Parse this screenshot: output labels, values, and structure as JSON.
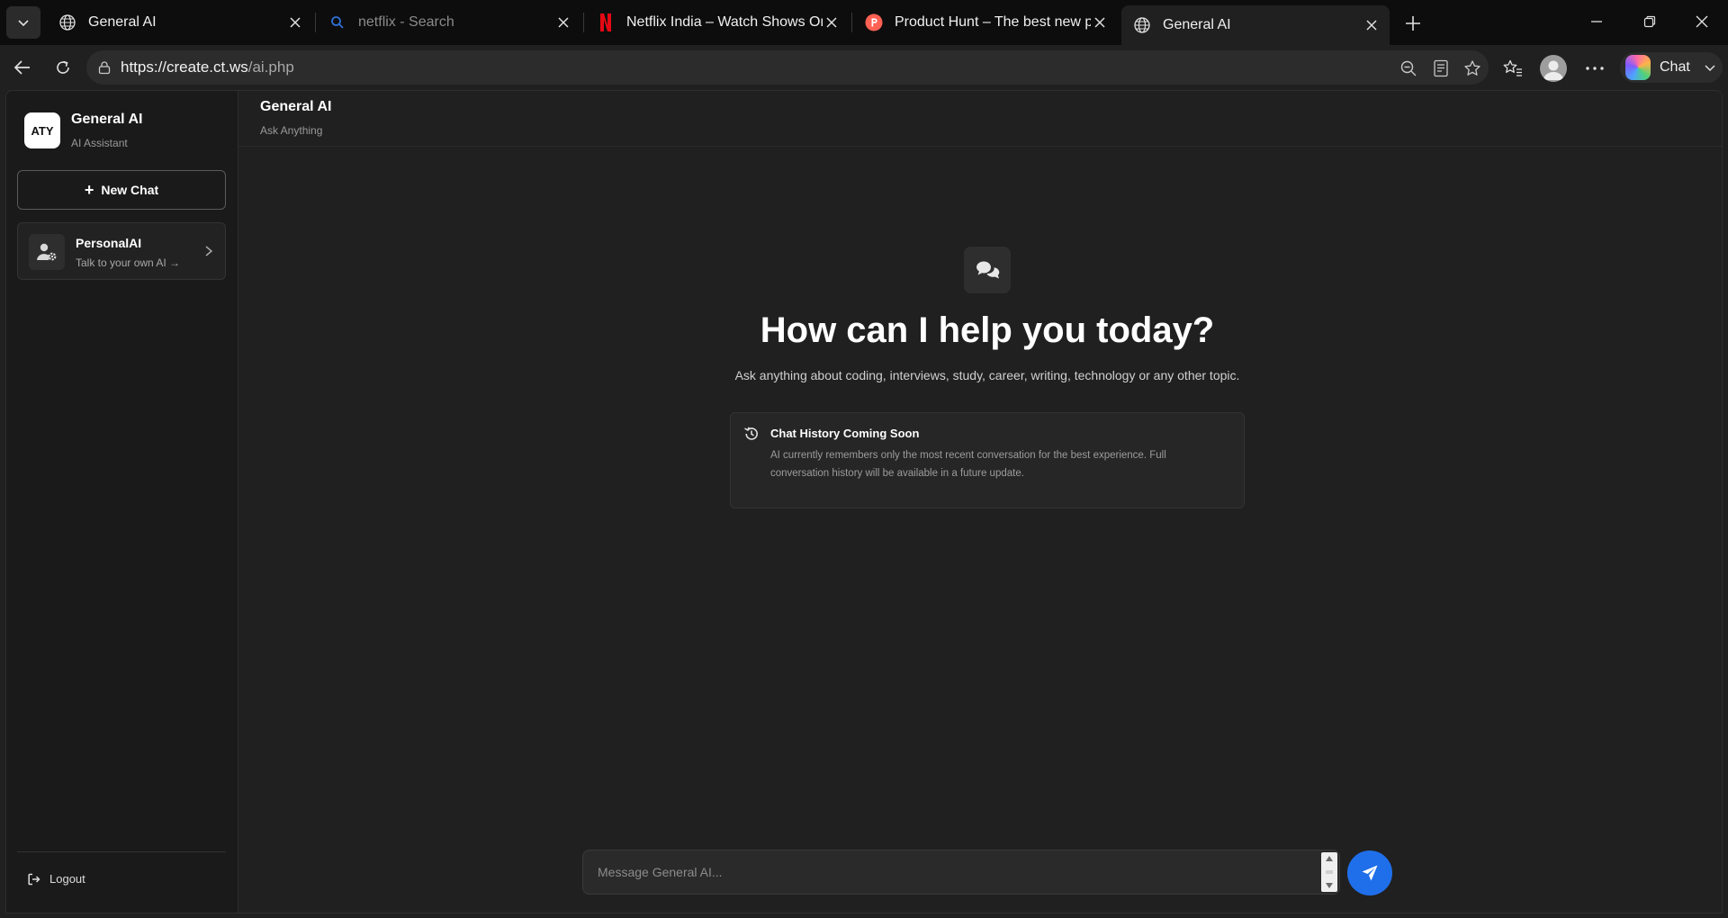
{
  "browser": {
    "tabs": [
      {
        "title": "General AI",
        "icon": "globe-icon",
        "active": false
      },
      {
        "title": "netflix - Search",
        "icon": "search-icon",
        "active": false
      },
      {
        "title": "Netflix India – Watch Shows Online",
        "icon": "netflix-icon",
        "active": false
      },
      {
        "title": "Product Hunt – The best new products",
        "icon": "product-hunt-icon",
        "active": false
      },
      {
        "title": "General AI",
        "icon": "globe-icon",
        "active": true
      }
    ],
    "url_host": "https://create.ct.ws",
    "url_path": "/ai.php",
    "copilot_label": "Chat"
  },
  "sidebar": {
    "logo_text": "ATY",
    "app_name": "General AI",
    "app_sub": "AI Assistant",
    "new_chat_label": "New Chat",
    "personal_card": {
      "title": "PersonalAI",
      "subtitle": "Talk to your own AI →"
    },
    "logout_label": "Logout"
  },
  "main": {
    "header_title": "General AI",
    "header_sub": "Ask Anything",
    "hero_title": "How can I help you today?",
    "hero_sub": "Ask anything about coding, interviews, study, career, writing, technology or any other topic.",
    "notice": {
      "title": "Chat History Coming Soon",
      "body": "AI currently remembers only the most recent conversation for the best experience. Full conversation history will be available in a future update."
    },
    "composer_placeholder": "Message General AI..."
  },
  "colors": {
    "accent": "#1f6fea",
    "background": "#202020",
    "sidebar": "#1a1a1a"
  }
}
